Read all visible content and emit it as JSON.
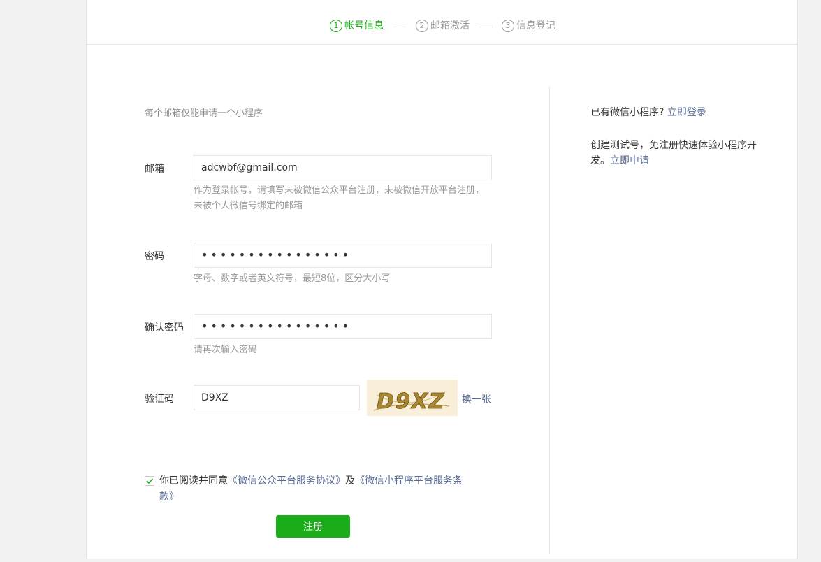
{
  "steps": [
    {
      "num": "1",
      "label": "帐号信息",
      "active": true
    },
    {
      "num": "2",
      "label": "邮箱激活",
      "active": false
    },
    {
      "num": "3",
      "label": "信息登记",
      "active": false
    }
  ],
  "form": {
    "tip": "每个邮箱仅能申请一个小程序",
    "email": {
      "label": "邮箱",
      "value": "adcwbf@gmail.com",
      "hint": "作为登录帐号，请填写未被微信公众平台注册，未被微信开放平台注册，未被个人微信号绑定的邮箱"
    },
    "password": {
      "label": "密码",
      "value": "••••••••••••••••",
      "hint": "字母、数字或者英文符号，最短8位，区分大小写"
    },
    "confirm": {
      "label": "确认密码",
      "value": "••••••••••••••••",
      "hint": "请再次输入密码"
    },
    "captcha": {
      "label": "验证码",
      "value": "D9XZ",
      "image_text": "D9XZ",
      "refresh": "换一张"
    },
    "agree": {
      "checked": true,
      "prefix": "你已阅读并同意",
      "link1": "《微信公众平台服务协议》",
      "middle": "及",
      "link2": "《微信小程序平台服务条款》"
    },
    "submit": "注册"
  },
  "side": {
    "has_account": "已有微信小程序?",
    "login_link": "立即登录",
    "test_text": "创建测试号，免注册快速体验小程序开发。",
    "apply_link": "立即申请"
  },
  "colors": {
    "accent": "#1aad19",
    "link": "#576b95"
  }
}
